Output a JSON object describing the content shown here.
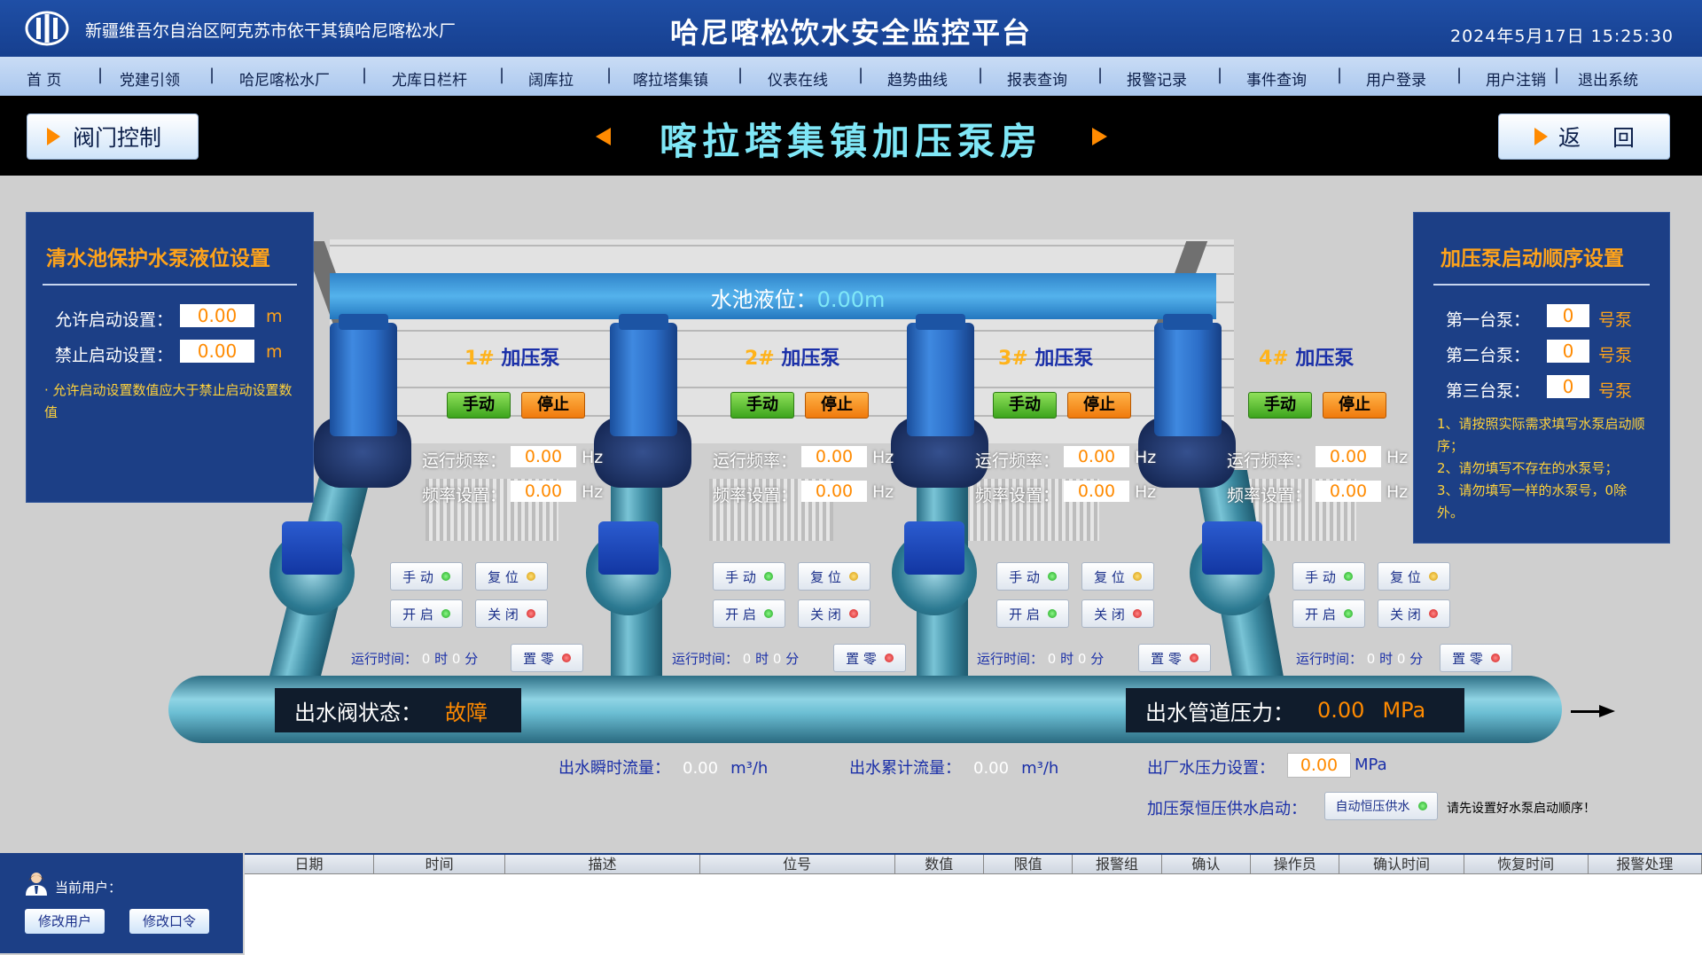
{
  "header": {
    "region": "新疆维吾尔自治区阿克苏市依干其镇哈尼喀松水厂",
    "title": "哈尼喀松饮水安全监控平台",
    "datetime": "2024年5月17日  15:25:30",
    "logo_icon": "water-utility-logo-icon"
  },
  "nav": {
    "items": [
      "首  页",
      "党建引领",
      "哈尼喀松水厂",
      "尤库日栏杆",
      "阔库拉",
      "喀拉塔集镇",
      "仪表在线",
      "趋势曲线",
      "报表查询",
      "报警记录",
      "事件查询",
      "用户登录",
      "用户注销",
      "退出系统"
    ],
    "separator": "|"
  },
  "toolbar": {
    "valve_control": "阀门控制",
    "station_name": "喀拉塔集镇加压泵房",
    "back": "返  回",
    "prev_icon": "left-triangle-icon",
    "next_icon": "right-triangle-icon"
  },
  "left_panel": {
    "title": "清水池保护水泵液位设置",
    "allow_label": "允许启动设置：",
    "allow_value": "0.00",
    "forbid_label": "禁止启动设置：",
    "forbid_value": "0.00",
    "unit": "m",
    "note": "· 允许启动设置数值应大于禁止启动设置数值"
  },
  "right_panel": {
    "title": "加压泵启动顺序设置",
    "pumps": [
      {
        "label": "第一台泵：",
        "value": "0",
        "unit": "号泵"
      },
      {
        "label": "第二台泵：",
        "value": "0",
        "unit": "号泵"
      },
      {
        "label": "第三台泵：",
        "value": "0",
        "unit": "号泵"
      }
    ],
    "notes": [
      "1、请按照实际需求填写水泵启动顺序；",
      "2、请勿填写不存在的水泵号；",
      "3、请勿填写一样的水泵号，0除外。"
    ]
  },
  "pool": {
    "label": "水池液位：",
    "value": "0.00m"
  },
  "pumps": [
    {
      "num": "1#",
      "name": "加压泵",
      "manual": "手动",
      "stop": "停止",
      "run_freq_label": "运行频率：",
      "run_freq": "0.00",
      "set_freq_label": "频率设置：",
      "set_freq": "0.00",
      "hz": "Hz",
      "btn_manual": "手 动",
      "btn_reset": "复 位",
      "btn_open": "开 启",
      "btn_close": "关 闭",
      "runtime_label": "运行时间：",
      "hours": "0",
      "hour_unit": "时",
      "minutes": "0",
      "minute_unit": "分",
      "btn_zero": "置 零"
    },
    {
      "num": "2#",
      "name": "加压泵",
      "manual": "手动",
      "stop": "停止",
      "run_freq_label": "运行频率：",
      "run_freq": "0.00",
      "set_freq_label": "频率设置：",
      "set_freq": "0.00",
      "hz": "Hz",
      "btn_manual": "手 动",
      "btn_reset": "复 位",
      "btn_open": "开 启",
      "btn_close": "关 闭",
      "runtime_label": "运行时间：",
      "hours": "0",
      "hour_unit": "时",
      "minutes": "0",
      "minute_unit": "分",
      "btn_zero": "置 零"
    },
    {
      "num": "3#",
      "name": "加压泵",
      "manual": "手动",
      "stop": "停止",
      "run_freq_label": "运行频率：",
      "run_freq": "0.00",
      "set_freq_label": "频率设置：",
      "set_freq": "0.00",
      "hz": "Hz",
      "btn_manual": "手 动",
      "btn_reset": "复 位",
      "btn_open": "开 启",
      "btn_close": "关 闭",
      "runtime_label": "运行时间：",
      "hours": "0",
      "hour_unit": "时",
      "minutes": "0",
      "minute_unit": "分",
      "btn_zero": "置 零"
    },
    {
      "num": "4#",
      "name": "加压泵",
      "manual": "手动",
      "stop": "停止",
      "run_freq_label": "运行频率：",
      "run_freq": "0.00",
      "set_freq_label": "频率设置：",
      "set_freq": "0.00",
      "hz": "Hz",
      "btn_manual": "手 动",
      "btn_reset": "复 位",
      "btn_open": "开 启",
      "btn_close": "关 闭",
      "runtime_label": "运行时间：",
      "hours": "0",
      "hour_unit": "时",
      "minutes": "0",
      "minute_unit": "分",
      "btn_zero": "置 零"
    }
  ],
  "outlet": {
    "valve_status_label": "出水阀状态：",
    "valve_status": "故障",
    "pressure_label": "出水管道压力：",
    "pressure_value": "0.00",
    "pressure_unit": "MPa",
    "flow_label": "出水瞬时流量：",
    "flow_value": "0.00",
    "flow_unit": "m³/h",
    "total_label": "出水累计流量：",
    "total_value": "0.00",
    "total_unit": "m³/h",
    "set_pressure_label": "出厂水压力设置：",
    "set_pressure_value": "0.00",
    "set_pressure_unit": "MPa",
    "const_label": "加压泵恒压供水启动：",
    "const_button": "自动恒压供水",
    "const_hint": "请先设置好水泵启动顺序！"
  },
  "footer": {
    "current_user_label": "当前用户：",
    "modify_user": "修改用户",
    "modify_password": "修改口令",
    "user_icon": "user-avatar-icon"
  },
  "alarm_table": {
    "columns": [
      "日期",
      "时间",
      "描述",
      "位号",
      "数值",
      "限值",
      "报警组",
      "确认",
      "操作员",
      "确认时间",
      "恢复时间",
      "报警处理"
    ]
  },
  "colors": {
    "header_blue": "#1c3f86",
    "accent_orange": "#ff8a00",
    "title_cyan": "#7fe7f7"
  }
}
